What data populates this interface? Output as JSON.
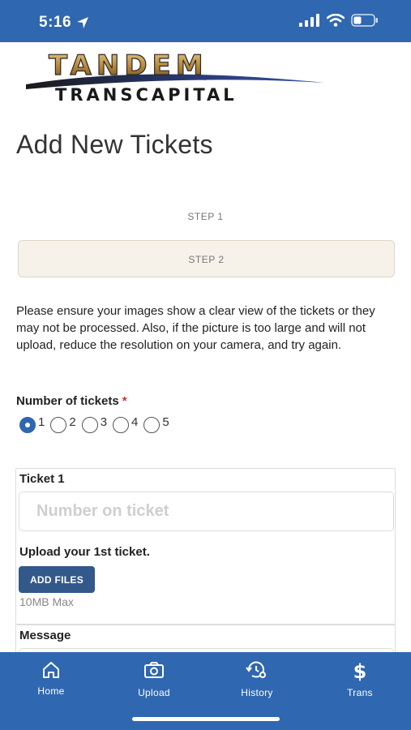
{
  "status_bar": {
    "time": "5:16"
  },
  "logo": {
    "line1": "TANDEM",
    "line2": "TRANSCAPITAL"
  },
  "page": {
    "title": "Add New Tickets"
  },
  "steps": {
    "step1": "STEP 1",
    "step2": "STEP 2"
  },
  "notice": "Please ensure your images show a clear view of the tickets or they may not be processed. Also, if the picture is too large and will not upload, reduce the resolution on your camera, and try again.",
  "ticket_count": {
    "label": "Number of tickets",
    "required_mark": "*",
    "options": [
      "1",
      "2",
      "3",
      "4",
      "5"
    ],
    "selected": "1"
  },
  "ticket1": {
    "label": "Ticket 1",
    "placeholder": "Number on ticket",
    "value": "",
    "upload_label": "Upload your 1st ticket.",
    "add_files": "ADD FILES",
    "max_note": "10MB Max"
  },
  "message": {
    "label": "Message"
  },
  "tabs": [
    {
      "label": "Home",
      "icon": "home-icon"
    },
    {
      "label": "Upload",
      "icon": "camera-icon"
    },
    {
      "label": "History",
      "icon": "history-icon"
    },
    {
      "label": "Trans",
      "icon": "dollar-icon"
    }
  ],
  "colors": {
    "header_blue": "#2f67b1",
    "button_blue": "#33588a",
    "step_bg": "#f6f2ea",
    "required_red": "#c0392b"
  }
}
